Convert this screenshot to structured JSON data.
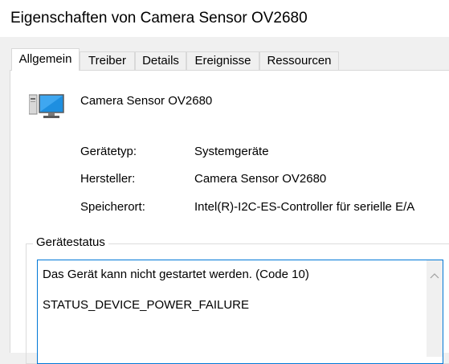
{
  "window": {
    "title": "Eigenschaften von Camera Sensor OV2680"
  },
  "tabs": [
    {
      "label": "Allgemein",
      "active": true
    },
    {
      "label": "Treiber",
      "active": false
    },
    {
      "label": "Details",
      "active": false
    },
    {
      "label": "Ereignisse",
      "active": false
    },
    {
      "label": "Ressourcen",
      "active": false
    }
  ],
  "device": {
    "name": "Camera Sensor OV2680",
    "icon": "camera-device-icon"
  },
  "properties": [
    {
      "label": "Gerätetyp:",
      "value": "Systemgeräte"
    },
    {
      "label": "Hersteller:",
      "value": "Camera Sensor OV2680"
    },
    {
      "label": "Speicherort:",
      "value": "Intel(R)-I2C-ES-Controller für serielle E/A"
    }
  ],
  "status": {
    "group_title": "Gerätestatus",
    "lines": [
      "Das Gerät kann nicht gestartet werden. (Code 10)",
      "STATUS_DEVICE_POWER_FAILURE"
    ]
  },
  "colors": {
    "focus_border": "#0078d7",
    "window_bg": "#f0f0f0",
    "page_bg": "#ffffff"
  }
}
